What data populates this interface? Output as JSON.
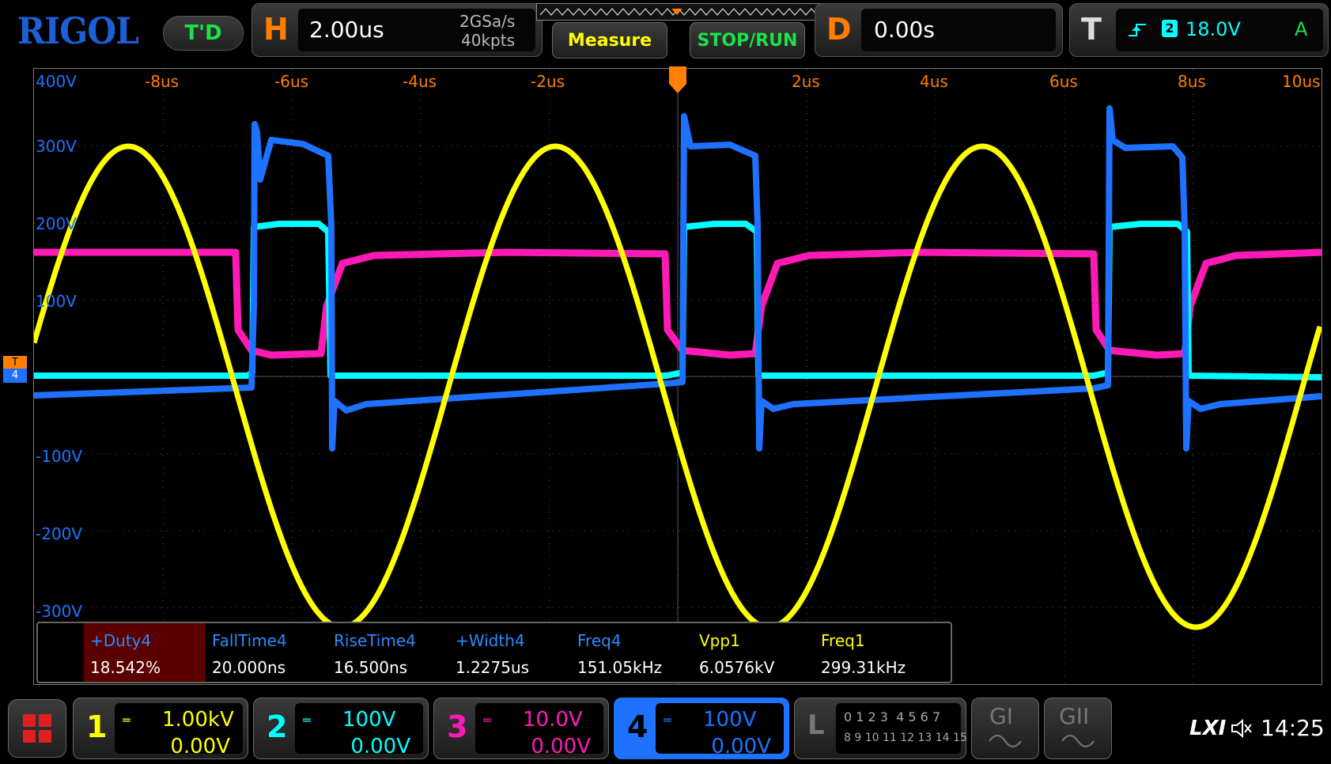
{
  "header": {
    "brand": "RIGOL",
    "trigger_state": "T'D",
    "horizontal": {
      "letter": "H",
      "timebase": "2.00us",
      "sample_rate": "2GSa/s",
      "memory_depth": "40kpts"
    },
    "measure_label": "Measure",
    "stop_run_label": "STOP/RUN",
    "delay": {
      "letter": "D",
      "value": "0.00s"
    },
    "trigger": {
      "letter": "T",
      "source_badge": "2",
      "level": "18.0V",
      "mode": "A"
    }
  },
  "graticule": {
    "x_ticks": [
      "-8us",
      "-6us",
      "-4us",
      "-2us",
      "2us",
      "4us",
      "6us",
      "8us",
      "10us"
    ],
    "y_ticks": [
      "400V",
      "300V",
      "200V",
      "100V",
      "-100V",
      "-200V",
      "-300V"
    ],
    "trigger_marker": "T",
    "ch4_marker": "4"
  },
  "measurements": [
    {
      "name": "+Duty4",
      "value": "18.542%",
      "highlight": true
    },
    {
      "name": "FallTime4",
      "value": "20.000ns"
    },
    {
      "name": "RiseTime4",
      "value": "16.500ns"
    },
    {
      "name": "+Width4",
      "value": "1.2275us"
    },
    {
      "name": "Freq4",
      "value": "151.05kHz"
    },
    {
      "name": "Vpp1",
      "value": "6.0576kV"
    },
    {
      "name": "Freq1",
      "value": "299.31kHz"
    }
  ],
  "channels": [
    {
      "num": "1",
      "scale": "1.00kV",
      "offset": "0.00V",
      "color": "#ffff00"
    },
    {
      "num": "2",
      "scale": "100V",
      "offset": "0.00V",
      "color": "#00ffff"
    },
    {
      "num": "3",
      "scale": "10.0V",
      "offset": "0.00V",
      "color": "#ff1ab5"
    },
    {
      "num": "4",
      "scale": "100V",
      "offset": "0.00V",
      "color": "#1e72ff",
      "active": true
    }
  ],
  "logic": {
    "letter": "L",
    "row1": "0 1 2 3  4 5 6 7",
    "row2": "8 9 10 11 12 13 14 15"
  },
  "generators": [
    "GI",
    "GII"
  ],
  "status": {
    "lxi": "LXI",
    "time": "14:25"
  },
  "colors": {
    "ch1": "#ffff00",
    "ch2": "#00ffff",
    "ch3": "#ff1ab5",
    "ch4": "#1e72ff",
    "accent_orange": "#ff7f00",
    "brand_blue": "#1d5fd6"
  },
  "icons": [
    "menu-grid-icon",
    "trigger-edge-icon",
    "speaker-muted-icon",
    "sine-wave-icon",
    "coupling-dc-icon"
  ]
}
